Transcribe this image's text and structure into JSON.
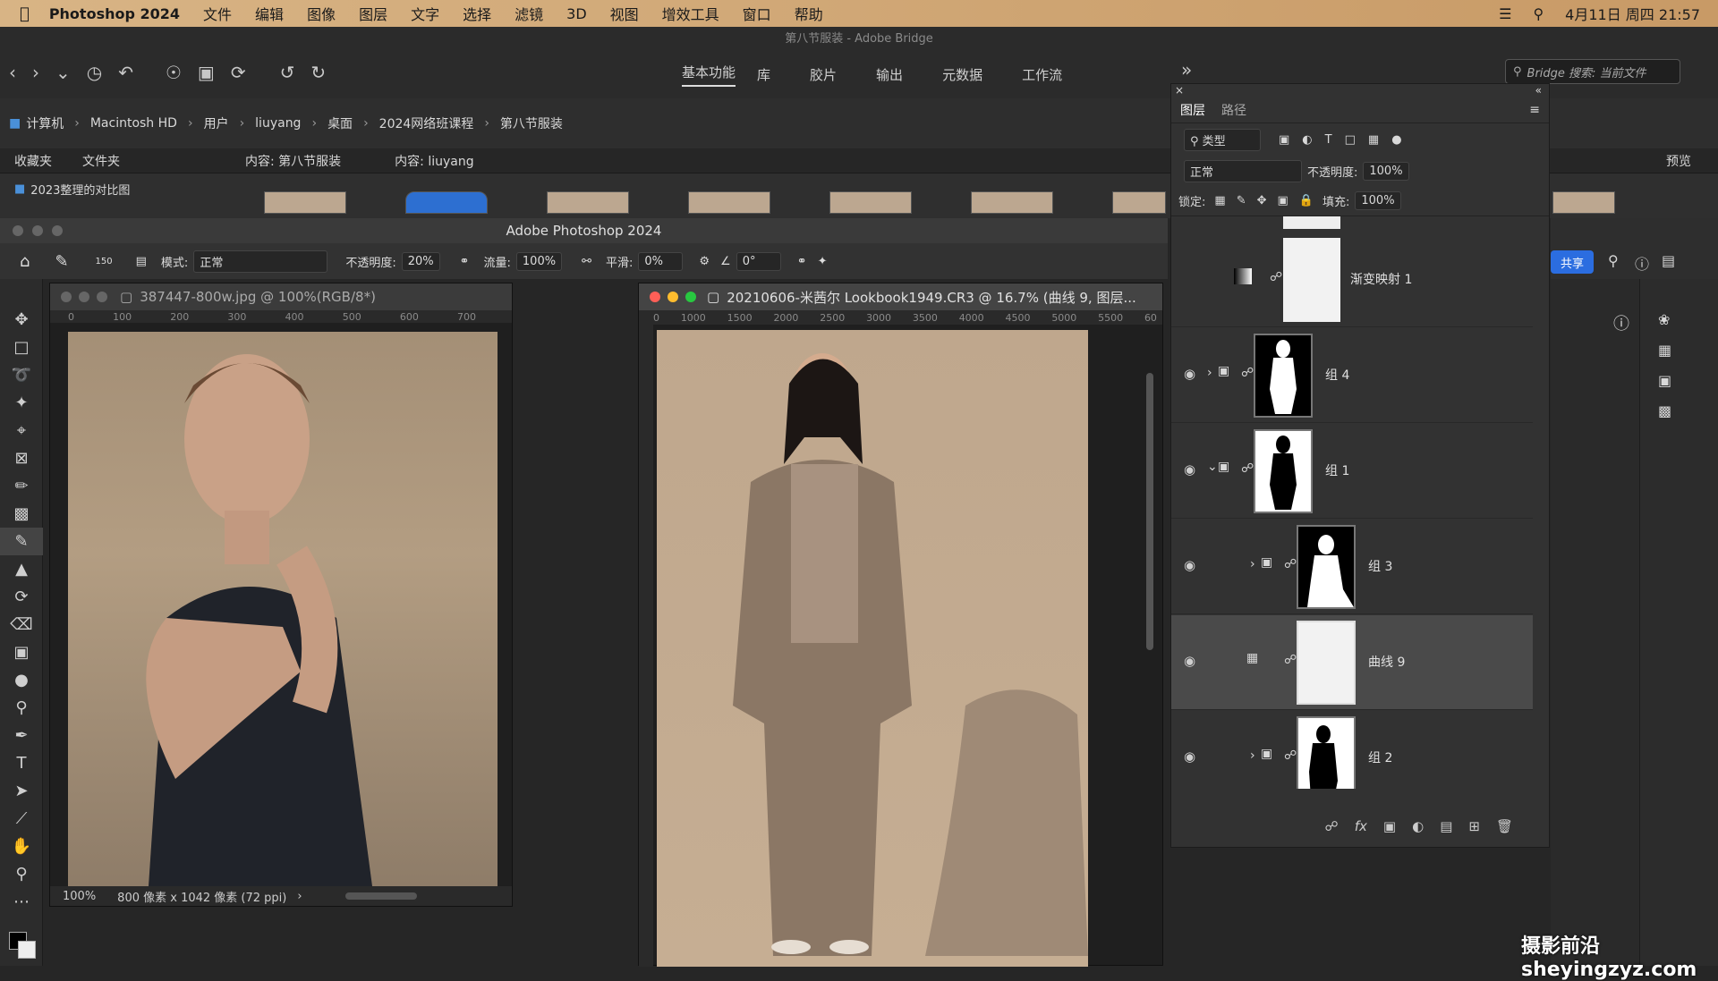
{
  "menubar": {
    "app_name": "Photoshop 2024",
    "items": [
      "文件",
      "编辑",
      "图像",
      "图层",
      "文字",
      "选择",
      "滤镜",
      "3D",
      "视图",
      "增效工具",
      "窗口",
      "帮助"
    ],
    "clock": "4月11日 周四 21:57"
  },
  "bridge": {
    "window_title": "第八节服装 - Adobe Bridge",
    "workspace_tabs": [
      "基本功能",
      "库",
      "胶片",
      "输出",
      "元数据",
      "工作流"
    ],
    "search_placeholder": "Bridge 搜索: 当前文件",
    "path": [
      "计算机",
      "Macintosh HD",
      "用户",
      "liuyang",
      "桌面",
      "2024网络班课程",
      "第八节服装"
    ],
    "left_tabs": [
      "收藏夹",
      "文件夹"
    ],
    "folder_item": "2023整理的对比图",
    "content_tab1": "内容: 第八节服装",
    "content_tab2": "内容: liuyang",
    "preview_label": "预览"
  },
  "photoshop": {
    "title": "Adobe Photoshop 2024",
    "options": {
      "brush_size": "150",
      "mode_label": "模式:",
      "mode_value": "正常",
      "opacity_label": "不透明度:",
      "opacity_value": "20%",
      "flow_label": "流量:",
      "flow_value": "100%",
      "smooth_label": "平滑:",
      "smooth_value": "0%",
      "angle_value": "0°",
      "share_label": "共享"
    },
    "doc1": {
      "title": "387447-800w.jpg @ 100%(RGB/8*)",
      "zoom": "100%",
      "info": "800 像素 x 1042 像素 (72 ppi)",
      "ruler": [
        "0",
        "100",
        "200",
        "300",
        "400",
        "500",
        "600",
        "700"
      ]
    },
    "doc2": {
      "title": "20210606-米茜尔 Lookbook1949.CR3 @ 16.7% (曲线 9, 图层...",
      "ruler": [
        "0",
        "1000",
        "1500",
        "2000",
        "2500",
        "3000",
        "3500",
        "4000",
        "4500",
        "5000",
        "5500",
        "60"
      ]
    }
  },
  "layers": {
    "tab_layers": "图层",
    "tab_paths": "路径",
    "filter_label": "类型",
    "blend_mode": "正常",
    "opacity_label": "不透明度:",
    "opacity_value": "100%",
    "lock_label": "锁定:",
    "fill_label": "填充:",
    "fill_value": "100%",
    "items": [
      {
        "name": "渐变映射 1"
      },
      {
        "name": "组 4"
      },
      {
        "name": "组 1"
      },
      {
        "name": "组 3"
      },
      {
        "name": "曲线 9"
      },
      {
        "name": "组 2"
      }
    ]
  },
  "watermark": "摄影前沿 sheyingzyz.com"
}
